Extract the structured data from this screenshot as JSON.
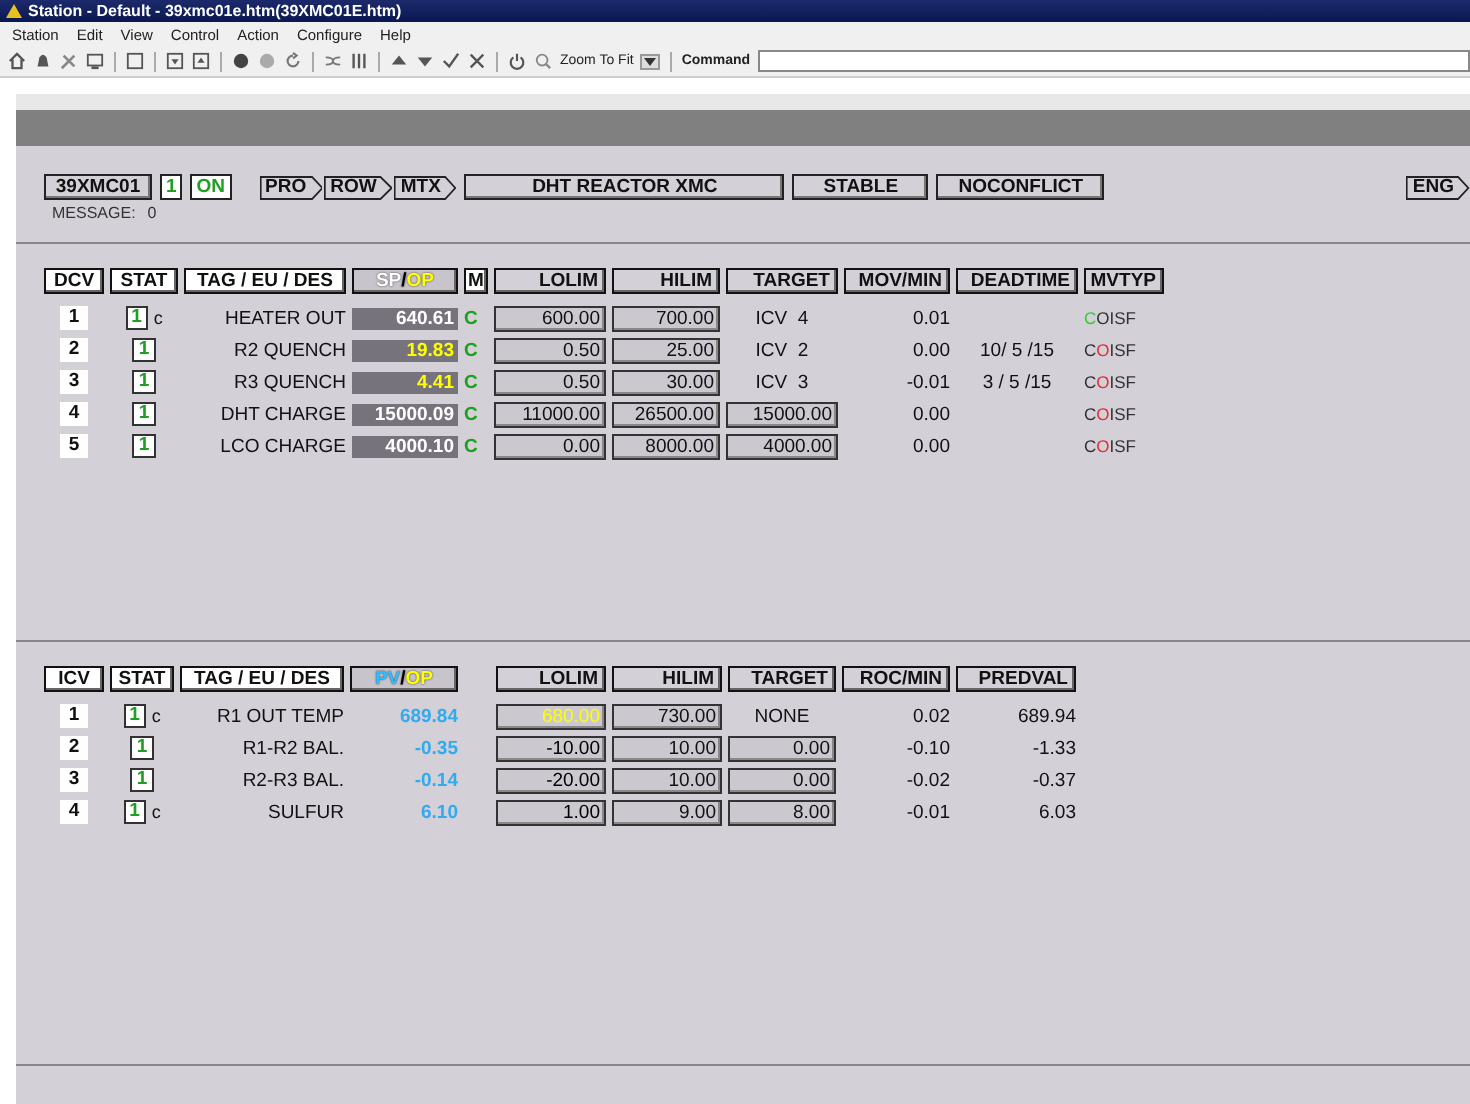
{
  "window": {
    "title": "Station - Default - 39xmc01e.htm(39XMC01E.htm)"
  },
  "menu": [
    "Station",
    "Edit",
    "View",
    "Control",
    "Action",
    "Configure",
    "Help"
  ],
  "toolbar": {
    "zoom": "Zoom To Fit",
    "command_label": "Command"
  },
  "header": {
    "unit": "39XMC01",
    "stat": "1",
    "mode": "ON",
    "nav": [
      "PRO",
      "ROW",
      "MTX"
    ],
    "title": "DHT REACTOR XMC",
    "status": "STABLE",
    "conflict": "NOCONFLICT",
    "eng": "ENG",
    "message_label": "MESSAGE:",
    "message_value": "0"
  },
  "dcv": {
    "columns": [
      {
        "label": "DCV"
      },
      {
        "label": "STAT"
      },
      {
        "label": "TAG / EU / DES"
      },
      {
        "parts": [
          {
            "text": "SP",
            "color": "#ffffff"
          },
          {
            "text": "/",
            "color": "#000000"
          },
          {
            "text": "OP",
            "color": "#ffff00"
          }
        ]
      },
      {
        "label": "M"
      },
      {
        "label": "LOLIM"
      },
      {
        "label": "HILIM"
      },
      {
        "label": "TARGET"
      },
      {
        "label": "MOV/MIN"
      },
      {
        "label": "DEADTIME"
      },
      {
        "label": "MVTYP"
      }
    ],
    "rows": [
      {
        "index": "1",
        "stat": "1",
        "flag": "c",
        "tag": "HEATER OUT",
        "sp": "640.61",
        "highlighted": false,
        "mode": "C",
        "lolim": "600.00",
        "hilim": "700.00",
        "target": {
          "kind": "text",
          "text": "ICV  4"
        },
        "mov": "0.01",
        "deadtime": "",
        "mvtyp": [
          {
            "text": "C",
            "color": "#33cc33"
          },
          {
            "text": "OI",
            "color": "#333333"
          },
          {
            "text": "SF",
            "color": "#333333"
          }
        ]
      },
      {
        "index": "2",
        "stat": "1",
        "flag": "",
        "tag": "R2 QUENCH",
        "sp": "19.83",
        "highlighted": true,
        "mode": "C",
        "lolim": "0.50",
        "hilim": "25.00",
        "target": {
          "kind": "text",
          "text": "ICV  2"
        },
        "mov": "0.00",
        "deadtime": "10/ 5 /15",
        "mvtyp": [
          {
            "text": "C",
            "color": "#333333"
          },
          {
            "text": "O",
            "color": "#e03030"
          },
          {
            "text": "I",
            "color": "#333333"
          },
          {
            "text": "SF",
            "color": "#333333"
          }
        ]
      },
      {
        "index": "3",
        "stat": "1",
        "flag": "",
        "tag": "R3 QUENCH",
        "sp": "4.41",
        "highlighted": true,
        "mode": "C",
        "lolim": "0.50",
        "hilim": "30.00",
        "target": {
          "kind": "text",
          "text": "ICV  3"
        },
        "mov": "-0.01",
        "deadtime": "3 / 5 /15",
        "mvtyp": [
          {
            "text": "C",
            "color": "#333333"
          },
          {
            "text": "O",
            "color": "#e03030"
          },
          {
            "text": "I",
            "color": "#333333"
          },
          {
            "text": "SF",
            "color": "#333333"
          }
        ]
      },
      {
        "index": "4",
        "stat": "1",
        "flag": "",
        "tag": "DHT CHARGE",
        "sp": "15000.09",
        "highlighted": false,
        "mode": "C",
        "lolim": "11000.00",
        "hilim": "26500.00",
        "target": {
          "kind": "field",
          "text": "15000.00"
        },
        "mov": "0.00",
        "deadtime": "",
        "mvtyp": [
          {
            "text": "C",
            "color": "#333333"
          },
          {
            "text": "O",
            "color": "#e03030"
          },
          {
            "text": "I",
            "color": "#333333"
          },
          {
            "text": "SF",
            "color": "#333333"
          }
        ]
      },
      {
        "index": "5",
        "stat": "1",
        "flag": "",
        "tag": "LCO CHARGE",
        "sp": "4000.10",
        "highlighted": false,
        "mode": "C",
        "lolim": "0.00",
        "hilim": "8000.00",
        "target": {
          "kind": "field",
          "text": "4000.00"
        },
        "mov": "0.00",
        "deadtime": "",
        "mvtyp": [
          {
            "text": "C",
            "color": "#333333"
          },
          {
            "text": "O",
            "color": "#e03030"
          },
          {
            "text": "I",
            "color": "#333333"
          },
          {
            "text": "SF",
            "color": "#333333"
          }
        ]
      }
    ]
  },
  "icv": {
    "columns": [
      {
        "label": "ICV"
      },
      {
        "label": "STAT"
      },
      {
        "label": "TAG / EU / DES"
      },
      {
        "parts": [
          {
            "text": "PV",
            "color": "#33bbff"
          },
          {
            "text": "/",
            "color": "#000000"
          },
          {
            "text": "OP",
            "color": "#ffff00"
          }
        ]
      },
      {
        "label": "LOLIM"
      },
      {
        "label": "HILIM"
      },
      {
        "label": "TARGET"
      },
      {
        "label": "ROC/MIN"
      },
      {
        "label": "PREDVAL"
      }
    ],
    "rows": [
      {
        "index": "1",
        "stat": "1",
        "flag": "c",
        "tag": "R1 OUT TEMP",
        "pv": "689.84",
        "lolim": {
          "text": "680.00",
          "color": "#ffff00"
        },
        "hilim": "730.00",
        "target": {
          "kind": "text",
          "text": "NONE"
        },
        "roc": "0.02",
        "predval": "689.94"
      },
      {
        "index": "2",
        "stat": "1",
        "flag": "",
        "tag": "R1-R2 BAL.",
        "pv": "-0.35",
        "lolim": {
          "text": "-10.00",
          "color": "#000000"
        },
        "hilim": "10.00",
        "target": {
          "kind": "field",
          "text": "0.00"
        },
        "roc": "-0.10",
        "predval": "-1.33"
      },
      {
        "index": "3",
        "stat": "1",
        "flag": "",
        "tag": "R2-R3 BAL.",
        "pv": "-0.14",
        "lolim": {
          "text": "-20.00",
          "color": "#000000"
        },
        "hilim": "10.00",
        "target": {
          "kind": "field",
          "text": "0.00"
        },
        "roc": "-0.02",
        "predval": "-0.37"
      },
      {
        "index": "4",
        "stat": "1",
        "flag": "c",
        "tag": "SULFUR",
        "pv": "6.10",
        "lolim": {
          "text": "1.00",
          "color": "#000000"
        },
        "hilim": "9.00",
        "target": {
          "kind": "field",
          "text": "8.00"
        },
        "roc": "-0.01",
        "predval": "6.03"
      }
    ]
  }
}
